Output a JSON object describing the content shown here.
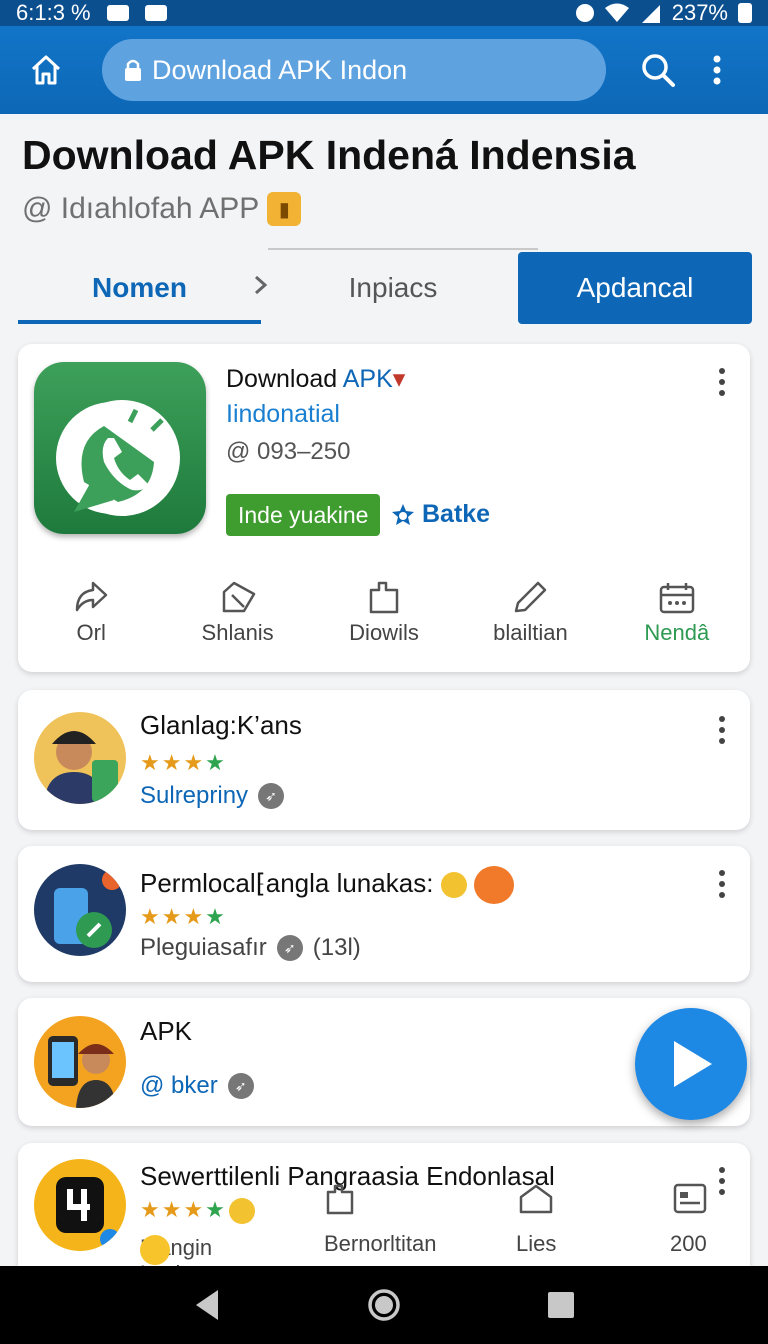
{
  "status_bar": {
    "time": "6:1:3 %",
    "battery": "237%"
  },
  "app_bar": {
    "url": "Download APK Indon"
  },
  "header": {
    "title": "Download APK Indená Indensia",
    "subtitle": "@ Idıahlofah APP"
  },
  "tabs": [
    {
      "label": "Nomen",
      "state": "selected"
    },
    {
      "label": "Inpiacs",
      "state": "normal"
    },
    {
      "label": "Apdancal",
      "state": "highlighted"
    }
  ],
  "featured": {
    "title_prefix": "Download ",
    "title_highlight": "APK",
    "subtitle": "Iindonatial",
    "meta": "@ 093–250",
    "badge": "Inde yuakine",
    "link": "Batke",
    "actions": [
      {
        "label": "Orl",
        "icon": "share-icon"
      },
      {
        "label": "Shlanis",
        "icon": "flag-icon"
      },
      {
        "label": "Diowils",
        "icon": "clipboard-icon"
      },
      {
        "label": "blailtian",
        "icon": "pencil-icon"
      },
      {
        "label": "Nendâ",
        "icon": "calendar-icon"
      }
    ]
  },
  "list": [
    {
      "title": "Glanlag:K’ans",
      "stars": "★★★",
      "star_green": "★",
      "meta": "Sulrepriny"
    },
    {
      "title": "Permlocal⁅angla lunakas:",
      "stars": "★★★",
      "star_green": "★",
      "meta": "Pleguiasafır",
      "count": "(13l)"
    },
    {
      "title": "APK",
      "meta": "@ bker"
    },
    {
      "title": "Sewerttilenli Pangraasia Endonlasal",
      "stars": "★★★",
      "star_green": "★",
      "meta": "Mangin Lacia",
      "col2": "Bernorltitan",
      "col3": "Lies",
      "col4": "200"
    }
  ],
  "colors": {
    "primary": "#0d67b6",
    "green": "#3f9c2f",
    "star": "#e59a1a"
  }
}
